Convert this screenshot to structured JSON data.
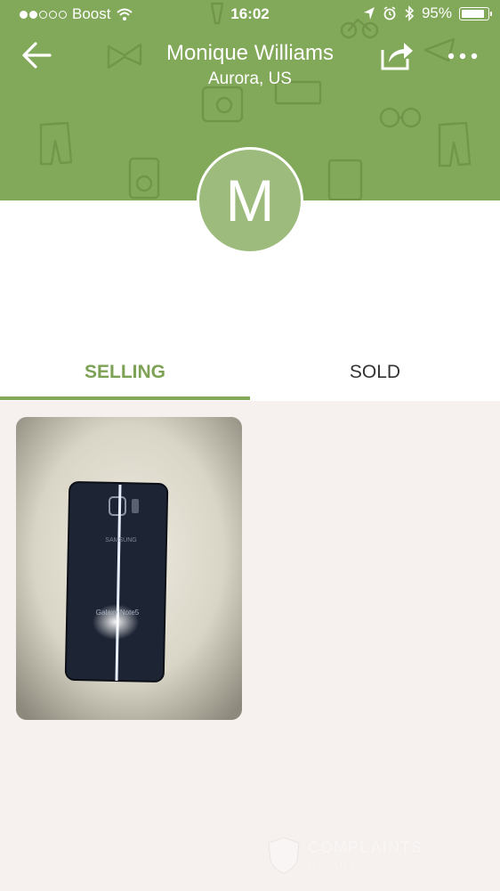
{
  "status_bar": {
    "carrier": "Boost",
    "time": "16:02",
    "battery": "95%",
    "battery_level": 0.95,
    "signal_bars_filled": 2,
    "signal_bars_total": 5
  },
  "header": {
    "title": "Monique Williams",
    "subtitle": "Aurora, US",
    "bg_color": "#82a85a",
    "back_icon": "arrow-left-icon",
    "share_icon": "share-icon",
    "more_icon": "more-dots-icon"
  },
  "profile": {
    "avatar_initial": "M",
    "avatar_color": "#9dbb7c"
  },
  "tabs": [
    {
      "label": "SELLING",
      "active": true
    },
    {
      "label": "SOLD",
      "active": false
    }
  ],
  "listings": [
    {
      "image": "phone-photo",
      "phone_brand": "SAMSUNG",
      "phone_model": "Galaxy Note5"
    }
  ],
  "watermark": {
    "line1": "COMPLAINTS",
    "line2": "BOARD"
  }
}
